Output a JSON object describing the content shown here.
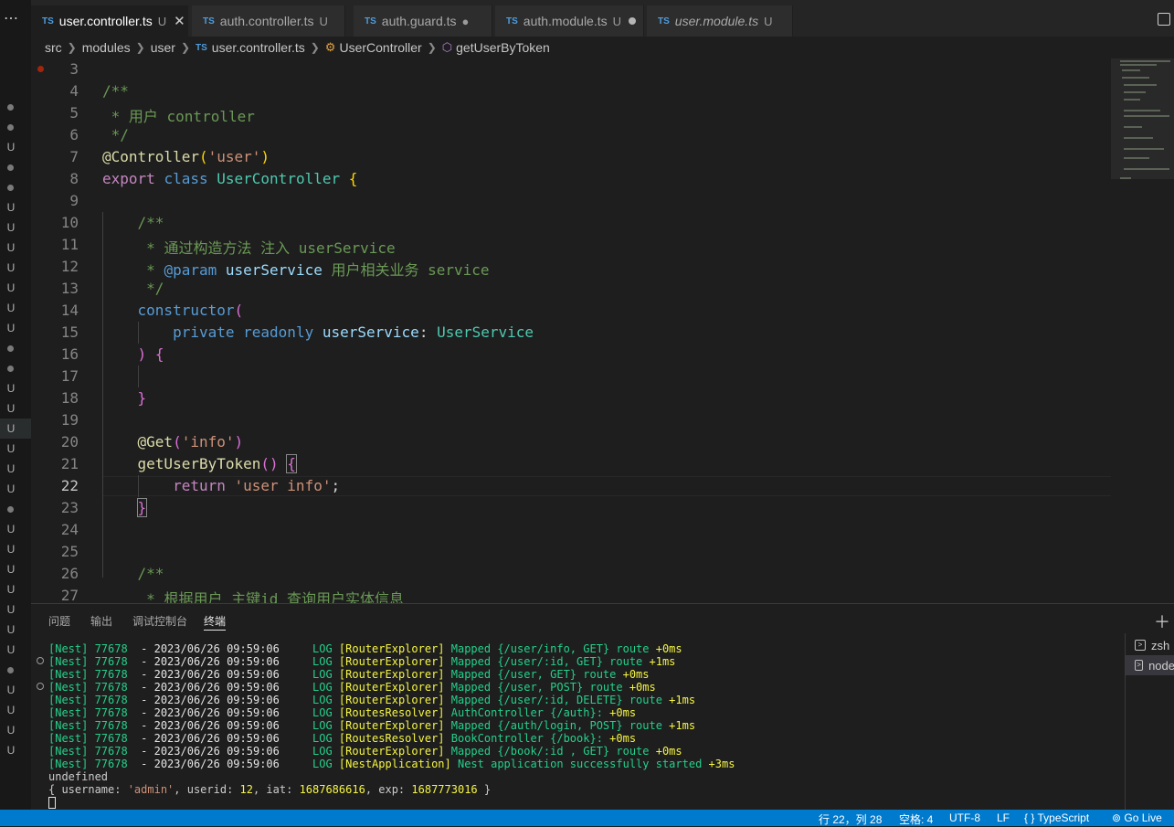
{
  "tabs": [
    {
      "lang": "TS",
      "name": "user.controller.ts",
      "status": "U",
      "active": true
    },
    {
      "lang": "TS",
      "name": "auth.controller.ts",
      "status": "U"
    },
    {
      "lang": "TS",
      "name": "auth.guard.ts",
      "status": "●"
    },
    {
      "lang": "TS",
      "name": "auth.module.ts",
      "status": "U"
    },
    {
      "lang": "TS",
      "name": "user.module.ts",
      "status": "U"
    }
  ],
  "breadcrumb": {
    "items": [
      "src",
      "modules",
      "user",
      "user.controller.ts",
      "UserController",
      "getUserByToken"
    ],
    "lang": "TS"
  },
  "editor": {
    "line_numbers": [
      "3",
      "4",
      "5",
      "6",
      "7",
      "8",
      "9",
      "10",
      "11",
      "12",
      "13",
      "14",
      "15",
      "16",
      "17",
      "18",
      "19",
      "20",
      "21",
      "22",
      "23",
      "24",
      "25",
      "26",
      "27"
    ],
    "current_line": "22"
  },
  "gutter_marks": [
    "U",
    "U",
    "U",
    "U",
    "U",
    "U",
    "U",
    "U",
    "U",
    "U",
    "U",
    "U",
    "U",
    "U",
    "U",
    "U",
    "U",
    "U",
    "U",
    "U",
    "U",
    "U",
    "U",
    "U",
    "U",
    "U",
    "U"
  ],
  "panel": {
    "tabs": [
      "问题",
      "输出",
      "调试控制台",
      "终端"
    ],
    "active_tab": "终端",
    "terminals": [
      "zsh",
      "node"
    ]
  },
  "terminal": {
    "logs": [
      {
        "pid": "[Nest] 77678",
        "ts": "- 2023/06/26 09:59:06",
        "level": "LOG",
        "ctx": "[RouterExplorer]",
        "msg": "Mapped {/user/info, GET} route",
        "time": "+0ms"
      },
      {
        "pid": "[Nest] 77678",
        "ts": "- 2023/06/26 09:59:06",
        "level": "LOG",
        "ctx": "[RouterExplorer]",
        "msg": "Mapped {/user/:id, GET} route",
        "time": "+1ms"
      },
      {
        "pid": "[Nest] 77678",
        "ts": "- 2023/06/26 09:59:06",
        "level": "LOG",
        "ctx": "[RouterExplorer]",
        "msg": "Mapped {/user, GET} route",
        "time": "+0ms"
      },
      {
        "pid": "[Nest] 77678",
        "ts": "- 2023/06/26 09:59:06",
        "level": "LOG",
        "ctx": "[RouterExplorer]",
        "msg": "Mapped {/user, POST} route",
        "time": "+0ms"
      },
      {
        "pid": "[Nest] 77678",
        "ts": "- 2023/06/26 09:59:06",
        "level": "LOG",
        "ctx": "[RouterExplorer]",
        "msg": "Mapped {/user/:id, DELETE} route",
        "time": "+1ms"
      },
      {
        "pid": "[Nest] 77678",
        "ts": "- 2023/06/26 09:59:06",
        "level": "LOG",
        "ctx": "[RoutesResolver]",
        "msg": "AuthController {/auth}:",
        "time": "+0ms"
      },
      {
        "pid": "[Nest] 77678",
        "ts": "- 2023/06/26 09:59:06",
        "level": "LOG",
        "ctx": "[RouterExplorer]",
        "msg": "Mapped {/auth/login, POST} route",
        "time": "+1ms"
      },
      {
        "pid": "[Nest] 77678",
        "ts": "- 2023/06/26 09:59:06",
        "level": "LOG",
        "ctx": "[RoutesResolver]",
        "msg": "BookController {/book}:",
        "time": "+0ms"
      },
      {
        "pid": "[Nest] 77678",
        "ts": "- 2023/06/26 09:59:06",
        "level": "LOG",
        "ctx": "[RouterExplorer]",
        "msg": "Mapped {/book/:id , GET} route",
        "time": "+0ms"
      },
      {
        "pid": "[Nest] 77678",
        "ts": "- 2023/06/26 09:59:06",
        "level": "LOG",
        "ctx": "[NestApplication]",
        "msg": "Nest application successfully started",
        "time": "+3ms"
      }
    ],
    "undefined_line": "undefined",
    "payload": {
      "username": "'admin'",
      "userid": "12",
      "iat": "1687686616",
      "exp": "1687773016"
    }
  },
  "statusbar": {
    "position": "行 22，列 28",
    "spaces": "空格: 4",
    "encoding": "UTF-8",
    "eol": "LF",
    "language": "TypeScript",
    "language_icon": "{ }",
    "live": "Go Live"
  },
  "colors": {
    "accent": "#007acc",
    "editor_bg": "#1e1e1e",
    "comment": "#6a9955",
    "keyword": "#569cd6"
  }
}
